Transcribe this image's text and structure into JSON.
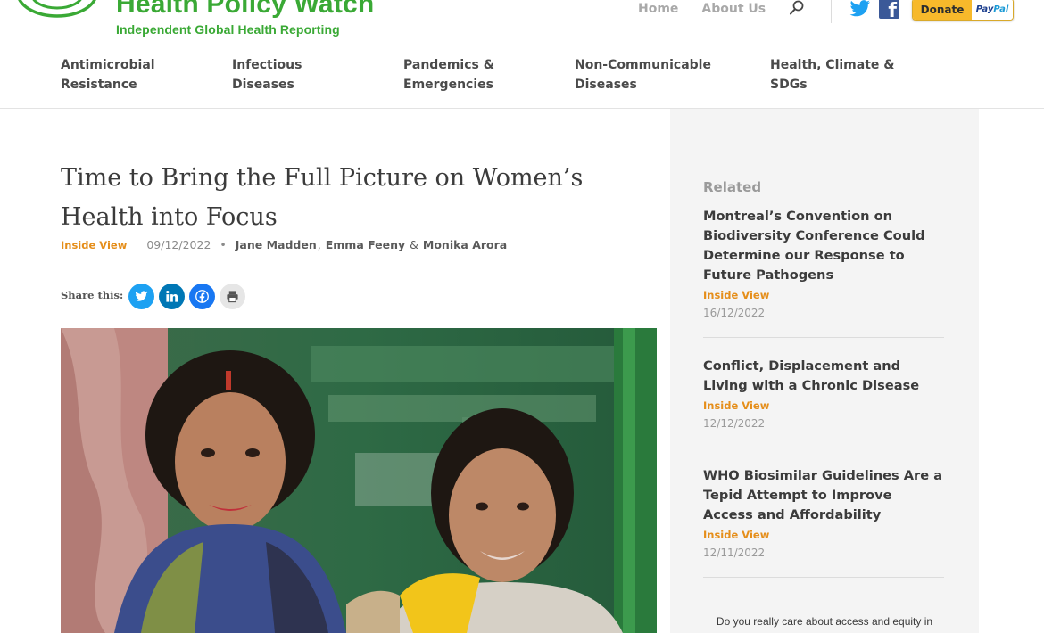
{
  "brand": {
    "name": "Health Policy Watch",
    "tagline": "Independent Global Health Reporting",
    "color": "#3aa935"
  },
  "topnav": {
    "items": [
      "Home",
      "About Us"
    ],
    "search_icon": "search-icon",
    "social_icons": [
      "twitter-icon",
      "facebook-icon"
    ],
    "donate": {
      "label": "Donate",
      "provider_pay": "Pay",
      "provider_pal": "Pal"
    }
  },
  "categories": [
    "Antimicrobial Resistance",
    "Infectious Diseases",
    "Pandemics & Emergencies",
    "Non-Communicable Diseases",
    "Health, Climate & SDGs"
  ],
  "article": {
    "title": "Time to Bring the Full Picture on Women’s Health into Focus",
    "category": "Inside View",
    "date": "09/12/2022",
    "authors": [
      "Jane Madden",
      "Emma Feeny",
      "Monika Arora"
    ],
    "author_separator": ",",
    "author_ampersand": "&",
    "share_label": "Share this:",
    "share_buttons": [
      "twitter-icon",
      "linkedin-icon",
      "facebook-icon",
      "print-icon"
    ],
    "image_icon": "photo-two-women"
  },
  "sidebar": {
    "heading": "Related",
    "items": [
      {
        "title": "Montreal’s Convention on Biodiversity Conference Could Determine our Response to Future Pathogens",
        "category": "Inside View",
        "date": "16/12/2022"
      },
      {
        "title": "Conflict, Displacement and Living with a Chronic Disease",
        "category": "Inside View",
        "date": "12/12/2022"
      },
      {
        "title": "WHO Biosimilar Guidelines Are a Tepid Attempt to Improve Access and Affordability",
        "category": "Inside View",
        "date": "12/11/2022"
      }
    ],
    "appeal": "Do you really care about access and equity in"
  },
  "colors": {
    "accent_orange": "#e58e1a",
    "brand_green": "#3aa935",
    "twitter": "#1da1f2",
    "linkedin": "#0077b5",
    "facebook": "#1877f2",
    "donate_yellow": "#f7b92b"
  }
}
